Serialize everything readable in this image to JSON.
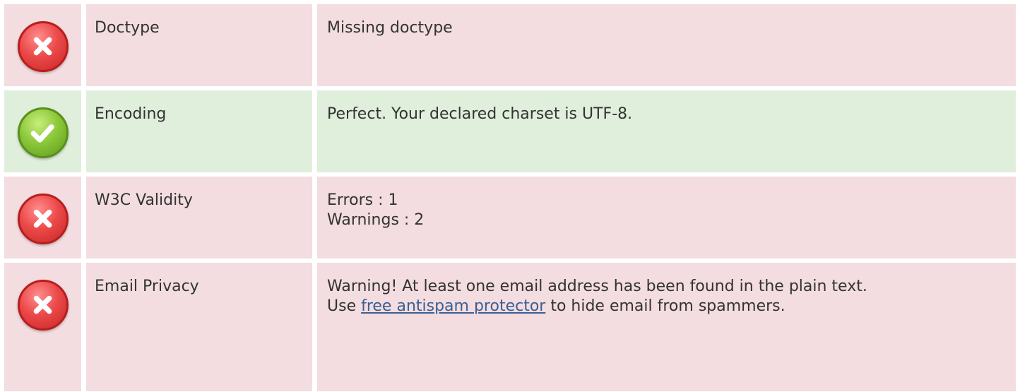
{
  "rows": [
    {
      "status": "error",
      "icon": "error-x-icon",
      "label": "Doctype",
      "value": "Missing doctype"
    },
    {
      "status": "ok",
      "icon": "success-check-icon",
      "label": "Encoding",
      "value": "Perfect. Your declared charset is UTF-8."
    },
    {
      "status": "error",
      "icon": "error-x-icon",
      "label": "W3C Validity",
      "lines": [
        "Errors : 1",
        "Warnings : 2"
      ]
    },
    {
      "status": "error",
      "icon": "error-x-icon",
      "label": "Email Privacy",
      "line1": "Warning! At least one email address has been found in the plain text.",
      "line2_prefix": "Use ",
      "link_text": "free antispam protector",
      "line2_suffix": " to hide email from spammers."
    }
  ],
  "colors": {
    "error_bg": "#f3dde0",
    "ok_bg": "#e0efdb",
    "link": "#3b5f92",
    "text": "#333333"
  }
}
